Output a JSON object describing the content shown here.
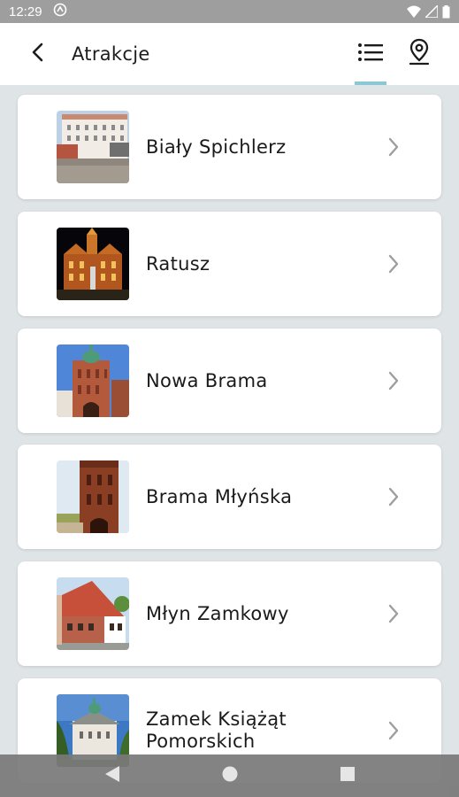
{
  "status_bar": {
    "time": "12:29"
  },
  "app_bar": {
    "title": "Atrakcje",
    "active_tab": "list"
  },
  "attractions": [
    {
      "name": "Biały Spichlerz"
    },
    {
      "name": "Ratusz"
    },
    {
      "name": "Nowa Brama"
    },
    {
      "name": "Brama Młyńska"
    },
    {
      "name": "Młyn Zamkowy"
    },
    {
      "name": "Zamek Książąt Pomorskich"
    }
  ],
  "colors": {
    "accent": "#8cc7d6",
    "background": "#dfe4e6",
    "card": "#ffffff",
    "chevron": "#9e9e9e"
  }
}
